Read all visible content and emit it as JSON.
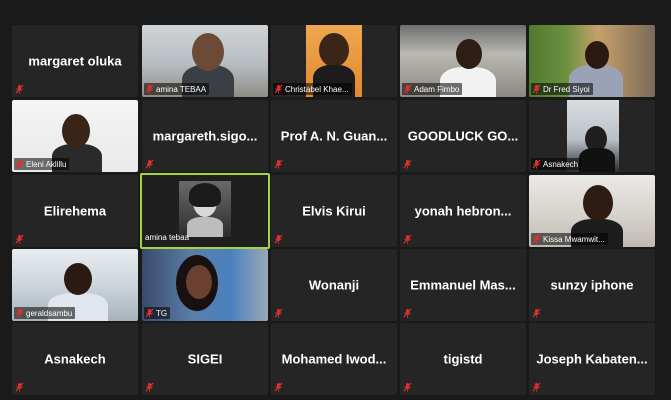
{
  "participants": [
    {
      "name": "margaret oluka",
      "video": false
    },
    {
      "name": "amina TEBAA",
      "video": true
    },
    {
      "name": "Christabel Khae...",
      "video": true
    },
    {
      "name": "Adam Fimbo",
      "video": true
    },
    {
      "name": "Dr Fred Siyoi",
      "video": true
    },
    {
      "name": "Eleni Aklillu",
      "video": true
    },
    {
      "name": "margareth.sigo...",
      "video": false
    },
    {
      "name": "Prof A. N. Guan...",
      "video": false
    },
    {
      "name": "GOODLUCK GO...",
      "video": false
    },
    {
      "name": "Asnakech",
      "video": true
    },
    {
      "name": "Elirehema",
      "video": false
    },
    {
      "name": "amina tebaa",
      "video": true,
      "active_speaker": true
    },
    {
      "name": "Elvis Kirui",
      "video": false
    },
    {
      "name": "yonah hebron...",
      "video": false
    },
    {
      "name": "Kissa Mwamwit...",
      "video": true
    },
    {
      "name": "geraldsambu",
      "video": true
    },
    {
      "name": "TG",
      "video": true
    },
    {
      "name": "Wonanji",
      "video": false
    },
    {
      "name": "Emmanuel Mas...",
      "video": false
    },
    {
      "name": "sunzy iphone",
      "video": false
    },
    {
      "name": "Asnakech",
      "video": false
    },
    {
      "name": "SIGEI",
      "video": false
    },
    {
      "name": "Mohamed Iwod...",
      "video": false
    },
    {
      "name": "tigistd",
      "video": false
    },
    {
      "name": "Joseph Kabaten...",
      "video": false
    }
  ],
  "colors": {
    "background": "#1a1a1a",
    "tile": "#252525",
    "active_border": "#a6d33c",
    "muted_icon": "#e0302a"
  },
  "icons": {
    "muted": "muted-mic-icon"
  }
}
